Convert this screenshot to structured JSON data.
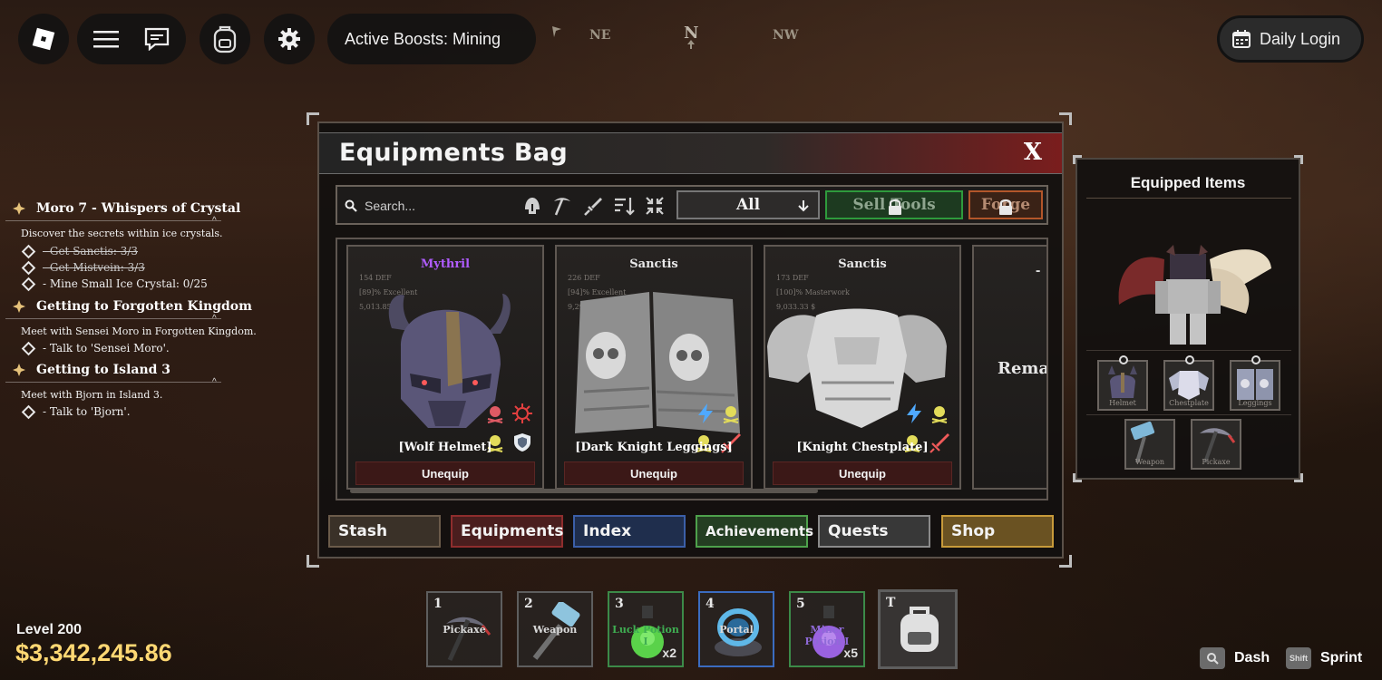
{
  "topbar": {
    "boost_label": "Active Boosts: Mining",
    "compass": [
      "NE",
      "N",
      "NW"
    ],
    "daily_login": "Daily Login"
  },
  "quests": [
    {
      "title": "Moro 7 - Whispers of Crystal",
      "desc": "Discover the secrets within ice crystals.",
      "tasks": [
        {
          "text": "- Get Sanctis: 3/3",
          "done": true
        },
        {
          "text": "- Get Mistvein: 3/3",
          "done": true
        },
        {
          "text": "- Mine Small Ice Crystal: 0/25",
          "done": false
        }
      ]
    },
    {
      "title": "Getting to Forgotten Kingdom",
      "desc": "Meet with Sensei Moro in Forgotten Kingdom.",
      "tasks": [
        {
          "text": "- Talk to 'Sensei Moro'.",
          "done": false
        }
      ]
    },
    {
      "title": "Getting to Island 3",
      "desc": "Meet with Bjorn in Island 3.",
      "tasks": [
        {
          "text": "- Talk to 'Bjorn'.",
          "done": false
        }
      ]
    }
  ],
  "bag": {
    "title": "Equipments Bag",
    "close": "X",
    "search_placeholder": "Search...",
    "filter_value": "All",
    "sell_label": "Sell Tools",
    "forge_label": "Forge",
    "items": [
      {
        "rarity": "Mythril",
        "rarity_color": "#b05cff",
        "def": "154 DEF",
        "quality": "[89]% Excellent",
        "price": "5,013.85 $",
        "name": "[Wolf Helmet]",
        "action": "Unequip"
      },
      {
        "rarity": "Sanctis",
        "rarity_color": "#e8e8e8",
        "def": "226 DEF",
        "quality": "[94]% Excellent",
        "price": "9,298.97 $",
        "name": "[Dark Knight Leggings]",
        "action": "Unequip"
      },
      {
        "rarity": "Sanctis",
        "rarity_color": "#e8e8e8",
        "def": "173 DEF",
        "quality": "[100]% Masterwork",
        "price": "9,033.33 $",
        "name": "[Knight Chestplate]",
        "action": "Unequip"
      }
    ],
    "partial_card": {
      "dash": "-",
      "text": "Remai"
    },
    "tabs": [
      "Stash",
      "Equipments",
      "Index",
      "Achievements",
      "Quests",
      "Shop"
    ]
  },
  "equipped": {
    "title": "Equipped Items",
    "slots": [
      "Helmet",
      "Chestplate",
      "Leggings",
      "Weapon",
      "Pickaxe"
    ]
  },
  "hotbar": [
    {
      "num": "1",
      "name": "Pickaxe",
      "count": "",
      "color": "#d8d8d8"
    },
    {
      "num": "2",
      "name": "Weapon",
      "count": "",
      "color": "#d8d8d8"
    },
    {
      "num": "3",
      "name": "Luck Potion I",
      "count": "x2",
      "color": "#3fae52"
    },
    {
      "num": "4",
      "name": "Portal",
      "count": "",
      "color": "#d8d8d8"
    },
    {
      "num": "5",
      "name": "Miner Potion I",
      "count": "x5",
      "color": "#8f6ad8"
    },
    {
      "num": "T",
      "name": "",
      "count": "",
      "color": "#d8d8d8"
    }
  ],
  "player": {
    "level": "Level 200",
    "money": "$3,342,245.86"
  },
  "keyhints": [
    {
      "key": "Q",
      "label": "Dash"
    },
    {
      "key": "Shift",
      "label": "Sprint"
    }
  ]
}
